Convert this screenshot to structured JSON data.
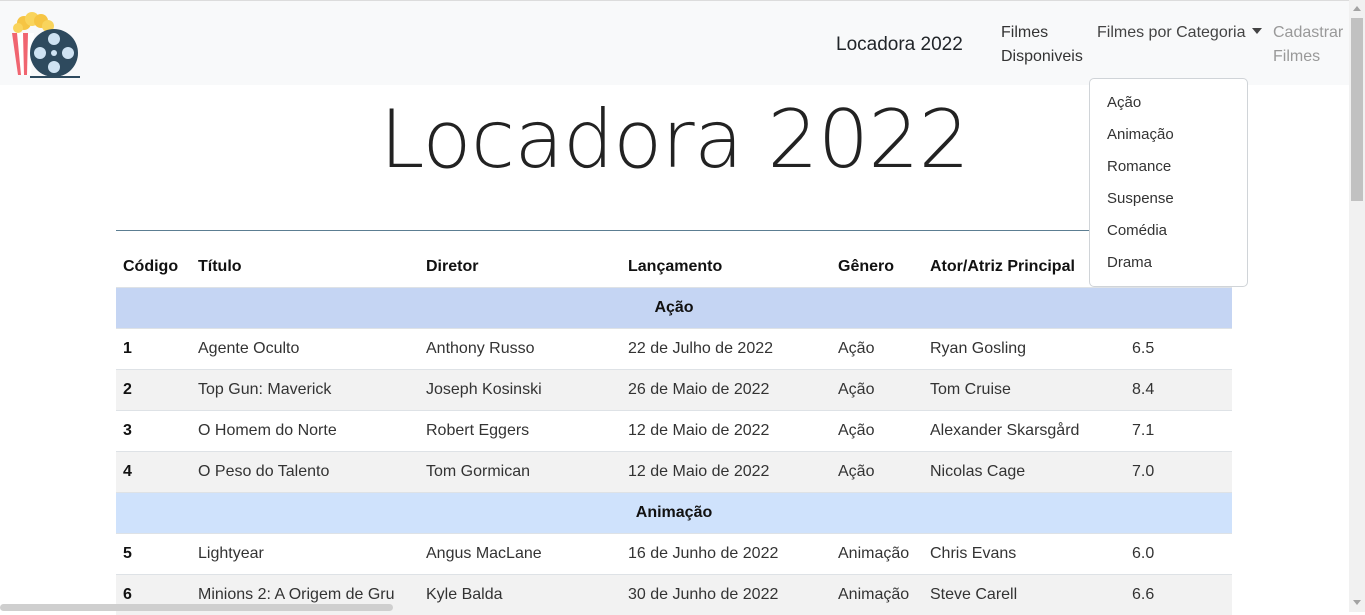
{
  "navbar": {
    "brand": "Locadora 2022",
    "items": [
      {
        "label": "Filmes Disponiveis"
      },
      {
        "label": "Filmes por Categoria"
      },
      {
        "label": "Cadastrar Filmes"
      }
    ]
  },
  "dropdown": {
    "items": [
      "Ação",
      "Animação",
      "Romance",
      "Suspense",
      "Comédia",
      "Drama"
    ]
  },
  "page": {
    "title": "Locadora 2022"
  },
  "table": {
    "headers": [
      "Código",
      "Título",
      "Diretor",
      "Lançamento",
      "Gênero",
      "Ator/Atriz Principal",
      ""
    ],
    "groups": [
      {
        "name": "Ação",
        "rows": [
          {
            "code": "1",
            "title": "Agente Oculto",
            "director": "Anthony Russo",
            "release": "22 de Julho de 2022",
            "genre": "Ação",
            "actor": "Ryan Gosling",
            "rating": "6.5"
          },
          {
            "code": "2",
            "title": "Top Gun: Maverick",
            "director": "Joseph Kosinski",
            "release": "26 de Maio de 2022",
            "genre": "Ação",
            "actor": "Tom Cruise",
            "rating": "8.4"
          },
          {
            "code": "3",
            "title": "O Homem do Norte",
            "director": "Robert Eggers",
            "release": "12 de Maio de 2022",
            "genre": "Ação",
            "actor": "Alexander Skarsgård",
            "rating": "7.1"
          },
          {
            "code": "4",
            "title": "O Peso do Talento",
            "director": "Tom Gormican",
            "release": "12 de Maio de 2022",
            "genre": "Ação",
            "actor": "Nicolas Cage",
            "rating": "7.0"
          }
        ]
      },
      {
        "name": "Animação",
        "rows": [
          {
            "code": "5",
            "title": "Lightyear",
            "director": "Angus MacLane",
            "release": "16 de Junho de 2022",
            "genre": "Animação",
            "actor": "Chris Evans",
            "rating": "6.0"
          },
          {
            "code": "6",
            "title": "Minions 2: A Origem de Gru",
            "director": "Kyle Balda",
            "release": "30 de Junho de 2022",
            "genre": "Animação",
            "actor": "Steve Carell",
            "rating": "6.6"
          }
        ]
      }
    ]
  },
  "colors": {
    "navbar_bg": "#f8f9fa",
    "group_acao_bg": "#c5d5f3",
    "group_animacao_bg": "#cfe2fc",
    "striped_row_bg": "#f2f2f2"
  },
  "icons": {
    "logo": "popcorn-film-reel-logo-icon",
    "dropdown_caret": "caret-down-icon"
  }
}
